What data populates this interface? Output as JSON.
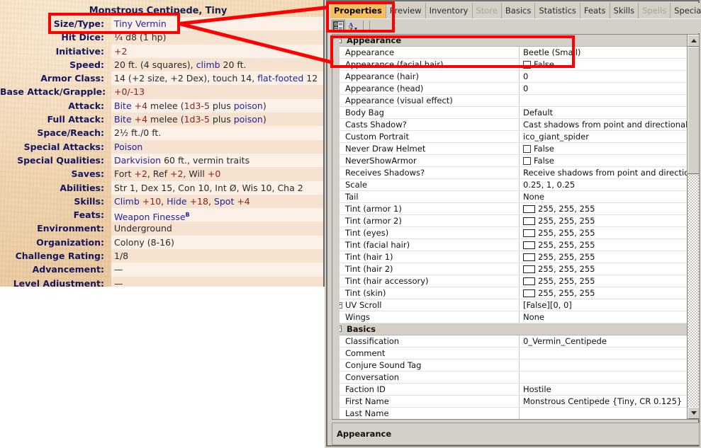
{
  "statblock": {
    "title": "Monstrous Centipede, Tiny",
    "rows": [
      {
        "label": "Size/Type:",
        "parts": [
          {
            "t": "Tiny Vermin",
            "c": "blu"
          }
        ]
      },
      {
        "label": "Hit Dice:",
        "parts": [
          {
            "t": "¼ d8 (1 hp)",
            "c": "blk"
          }
        ]
      },
      {
        "label": "Initiative:",
        "parts": [
          {
            "t": "+2",
            "c": "red"
          }
        ]
      },
      {
        "label": "Speed:",
        "parts": [
          {
            "t": "20 ft. (4 squares), ",
            "c": "blk"
          },
          {
            "t": "climb",
            "c": "blu"
          },
          {
            "t": " 20 ft.",
            "c": "blk"
          }
        ]
      },
      {
        "label": "Armor Class:",
        "parts": [
          {
            "t": "14 (+2 size, +2 Dex), touch 14, ",
            "c": "blk"
          },
          {
            "t": "flat-footed",
            "c": "blu"
          },
          {
            "t": " 12",
            "c": "blk"
          }
        ]
      },
      {
        "label": "Base Attack/Grapple:",
        "parts": [
          {
            "t": "+0/-13",
            "c": "red"
          }
        ]
      },
      {
        "label": "Attack:",
        "parts": [
          {
            "t": "Bite",
            "c": "blu"
          },
          {
            "t": " +4",
            "c": "red"
          },
          {
            "t": " melee (",
            "c": "blk"
          },
          {
            "t": "1d3-5",
            "c": "red"
          },
          {
            "t": " plus ",
            "c": "blk"
          },
          {
            "t": "poison",
            "c": "blu"
          },
          {
            "t": ")",
            "c": "blk"
          }
        ]
      },
      {
        "label": "Full Attack:",
        "parts": [
          {
            "t": "Bite",
            "c": "blu"
          },
          {
            "t": " +4",
            "c": "red"
          },
          {
            "t": " melee (",
            "c": "blk"
          },
          {
            "t": "1d3-5",
            "c": "red"
          },
          {
            "t": " plus ",
            "c": "blk"
          },
          {
            "t": "poison",
            "c": "blu"
          },
          {
            "t": ")",
            "c": "blk"
          }
        ]
      },
      {
        "label": "Space/Reach:",
        "parts": [
          {
            "t": "2½ ft./0 ft.",
            "c": "blk"
          }
        ]
      },
      {
        "label": "Special Attacks:",
        "parts": [
          {
            "t": "Poison",
            "c": "blu"
          }
        ]
      },
      {
        "label": "Special Qualities:",
        "parts": [
          {
            "t": "Darkvision",
            "c": "blu"
          },
          {
            "t": " 60 ft., vermin traits",
            "c": "blk"
          }
        ]
      },
      {
        "label": "Saves:",
        "parts": [
          {
            "t": "Fort ",
            "c": "blk"
          },
          {
            "t": "+2",
            "c": "red"
          },
          {
            "t": ", Ref ",
            "c": "blk"
          },
          {
            "t": "+2",
            "c": "red"
          },
          {
            "t": ", Will ",
            "c": "blk"
          },
          {
            "t": "+0",
            "c": "red"
          }
        ]
      },
      {
        "label": "Abilities:",
        "parts": [
          {
            "t": "Str 1, Dex 15, Con 10, Int Ø, Wis 10, Cha 2",
            "c": "blk"
          }
        ]
      },
      {
        "label": "Skills:",
        "parts": [
          {
            "t": "Climb",
            "c": "blu"
          },
          {
            "t": " +10",
            "c": "red"
          },
          {
            "t": ", ",
            "c": "blk"
          },
          {
            "t": "Hide",
            "c": "blu"
          },
          {
            "t": " +18",
            "c": "red"
          },
          {
            "t": ", ",
            "c": "blk"
          },
          {
            "t": "Spot",
            "c": "blu"
          },
          {
            "t": " +4",
            "c": "red"
          }
        ]
      },
      {
        "label": "Feats:",
        "parts": [
          {
            "t": "Weapon Finesse",
            "c": "blu"
          },
          {
            "t": "B",
            "c": "sup"
          }
        ]
      },
      {
        "label": "Environment:",
        "parts": [
          {
            "t": "Underground",
            "c": "blk"
          }
        ]
      },
      {
        "label": "Organization:",
        "parts": [
          {
            "t": "Colony (8-16)",
            "c": "blk"
          }
        ]
      },
      {
        "label": "Challenge Rating:",
        "parts": [
          {
            "t": "1/8",
            "c": "blk"
          }
        ]
      },
      {
        "label": "Advancement:",
        "parts": [
          {
            "t": "—",
            "c": "blk"
          }
        ]
      },
      {
        "label": "Level Adjustment:",
        "parts": [
          {
            "t": "—",
            "c": "blk"
          }
        ]
      }
    ]
  },
  "pane": {
    "tabs": [
      {
        "label": "Properties",
        "state": "active"
      },
      {
        "label": "Preview",
        "state": "normal"
      },
      {
        "label": "Inventory",
        "state": "normal"
      },
      {
        "label": "Store",
        "state": "disabled"
      },
      {
        "label": "Basics",
        "state": "normal"
      },
      {
        "label": "Statistics",
        "state": "normal"
      },
      {
        "label": "Feats",
        "state": "normal"
      },
      {
        "label": "Skills",
        "state": "normal"
      },
      {
        "label": "Spells",
        "state": "disabled"
      },
      {
        "label": "Special Abili",
        "state": "normal"
      }
    ],
    "tabnav": {
      "prev": "◁",
      "next": "▶",
      "close": "✕"
    },
    "toolbar": {
      "categorized_icon": "categorized-view-icon",
      "alphabetical_icon": "alphabetical-sort-icon",
      "sort_label": "A"
    },
    "statusbar": {
      "text": "Appearance"
    },
    "grid": [
      {
        "kind": "group",
        "name": "Appearance",
        "expander": "−"
      },
      {
        "kind": "row",
        "name": "Appearance",
        "value": "Beetle (Small)",
        "type": "text"
      },
      {
        "kind": "row",
        "name": "Appearance (facial hair)",
        "value": "False",
        "type": "checkbox"
      },
      {
        "kind": "row",
        "name": "Appearance (hair)",
        "value": "0",
        "type": "text"
      },
      {
        "kind": "row",
        "name": "Appearance (head)",
        "value": "0",
        "type": "text"
      },
      {
        "kind": "row",
        "name": "Appearance (visual effect)",
        "value": "",
        "type": "text"
      },
      {
        "kind": "row",
        "name": "Body Bag",
        "value": "Default",
        "type": "text"
      },
      {
        "kind": "row",
        "name": "Casts Shadow?",
        "value": "Cast shadows from point and directional lights",
        "type": "text"
      },
      {
        "kind": "row",
        "name": "Custom Portrait",
        "value": "ico_giant_spider",
        "type": "text"
      },
      {
        "kind": "row",
        "name": "Never Draw Helmet",
        "value": "False",
        "type": "checkbox"
      },
      {
        "kind": "row",
        "name": "NeverShowArmor",
        "value": "False",
        "type": "checkbox"
      },
      {
        "kind": "row",
        "name": "Receives Shadows?",
        "value": "Receive shadows from point and directional lights",
        "type": "text"
      },
      {
        "kind": "row",
        "name": "Scale",
        "value": "0.25, 1, 0.25",
        "type": "text"
      },
      {
        "kind": "row",
        "name": "Tail",
        "value": "None",
        "type": "text"
      },
      {
        "kind": "row",
        "name": "Tint (armor 1)",
        "value": "255, 255, 255",
        "type": "color",
        "swatch": "#ffffff"
      },
      {
        "kind": "row",
        "name": "Tint (armor 2)",
        "value": "255, 255, 255",
        "type": "color",
        "swatch": "#ffffff"
      },
      {
        "kind": "row",
        "name": "Tint (eyes)",
        "value": "255, 255, 255",
        "type": "color",
        "swatch": "#ffffff"
      },
      {
        "kind": "row",
        "name": "Tint (facial hair)",
        "value": "255, 255, 255",
        "type": "color",
        "swatch": "#ffffff"
      },
      {
        "kind": "row",
        "name": "Tint (hair 1)",
        "value": "255, 255, 255",
        "type": "color",
        "swatch": "#ffffff"
      },
      {
        "kind": "row",
        "name": "Tint (hair 2)",
        "value": "255, 255, 255",
        "type": "color",
        "swatch": "#ffffff"
      },
      {
        "kind": "row",
        "name": "Tint (hair accessory)",
        "value": "255, 255, 255",
        "type": "color",
        "swatch": "#ffffff"
      },
      {
        "kind": "row",
        "name": "Tint (skin)",
        "value": "255, 255, 255",
        "type": "color",
        "swatch": "#ffffff"
      },
      {
        "kind": "row",
        "name": "UV Scroll",
        "value": "[False][0, 0]",
        "type": "text",
        "expander": "+"
      },
      {
        "kind": "row",
        "name": "Wings",
        "value": "None",
        "type": "text"
      },
      {
        "kind": "group",
        "name": "Basics",
        "expander": "−"
      },
      {
        "kind": "row",
        "name": "Classification",
        "value": "0_Vermin_Centipede",
        "type": "text"
      },
      {
        "kind": "row",
        "name": "Comment",
        "value": "",
        "type": "text"
      },
      {
        "kind": "row",
        "name": "Conjure Sound Tag",
        "value": "",
        "type": "text"
      },
      {
        "kind": "row",
        "name": "Conversation",
        "value": "",
        "type": "text"
      },
      {
        "kind": "row",
        "name": "Faction ID",
        "value": "Hostile",
        "type": "text"
      },
      {
        "kind": "row",
        "name": "First Name",
        "value": "Monstrous Centipede {Tiny, CR 0.125}",
        "type": "text"
      },
      {
        "kind": "row",
        "name": "Last Name",
        "value": "",
        "type": "text"
      }
    ]
  },
  "annotations": {
    "color": "#ff0000",
    "boxes": [
      "size-type-highlight",
      "properties-tab-highlight",
      "appearance-row-highlight"
    ],
    "connector_count": 2
  }
}
